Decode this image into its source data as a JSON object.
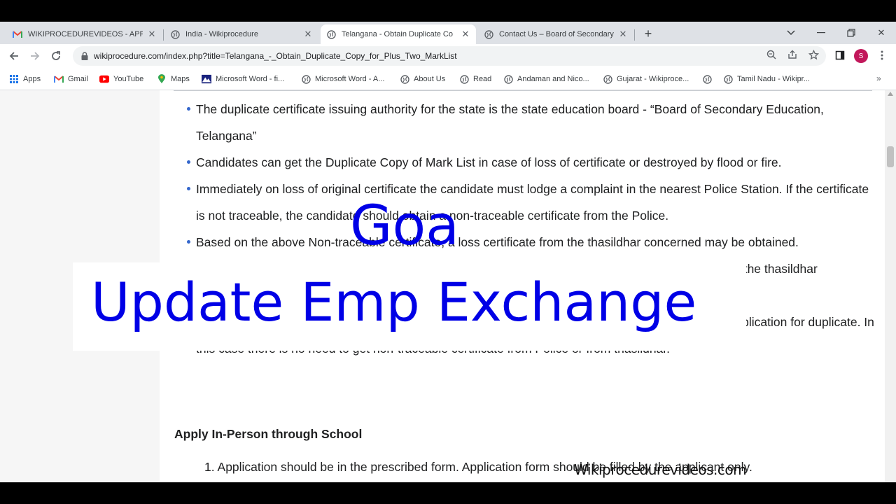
{
  "browser": {
    "tabs": [
      {
        "title": "WIKIPROCEDUREVIDEOS - APRIL",
        "favicon": "gmail-icon",
        "active": false
      },
      {
        "title": "India - Wikiprocedure",
        "favicon": "globe-icon",
        "active": false
      },
      {
        "title": "Telangana - Obtain Duplicate Co",
        "favicon": "globe-icon",
        "active": true
      },
      {
        "title": "Contact Us – Board of Secondary",
        "favicon": "globe-icon",
        "active": false
      }
    ],
    "address_bar": {
      "url": "wikiprocedure.com/index.php?title=Telangana_-_Obtain_Duplicate_Copy_for_Plus_Two_MarkList"
    },
    "profile_initial": "S",
    "bookmarks": [
      {
        "label": "Apps",
        "icon": "apps-grid-icon"
      },
      {
        "label": "Gmail",
        "icon": "gmail-icon"
      },
      {
        "label": "YouTube",
        "icon": "youtube-icon"
      },
      {
        "label": "Maps",
        "icon": "maps-pin-icon"
      },
      {
        "label": "Microsoft Word - fi...",
        "icon": "mountain-icon"
      },
      {
        "label": "Microsoft Word - A...",
        "icon": "globe-icon"
      },
      {
        "label": "About Us",
        "icon": "globe-icon"
      },
      {
        "label": "Read",
        "icon": "globe-icon"
      },
      {
        "label": "Andaman and Nico...",
        "icon": "globe-icon"
      },
      {
        "label": "Gujarat - Wikiproce...",
        "icon": "globe-icon"
      },
      {
        "label": "",
        "icon": "globe-icon"
      },
      {
        "label": "Tamil Nadu - Wikipr...",
        "icon": "globe-icon"
      }
    ],
    "colors": {
      "tab_strip": "#dee1e6",
      "avatar": "#c2185b"
    }
  },
  "article": {
    "bullets": [
      {
        "text": "The duplicate certificate issuing authority for the state is the state education board - “Board of Secondary Education, Telangana”"
      },
      {
        "text": "Candidates can get the Duplicate Copy of Mark List in case of loss of certificate or destroyed by flood or fire."
      },
      {
        "text": "Immediately on loss of original certificate the candidate must lodge a complaint in the nearest Police Station. If the certificate is not traceable, the candidate should obtain a non-traceable certificate from the Police."
      },
      {
        "text": "Based on the above Non-traceable certificate, a loss certificate from the thasildhar concerned may be obtained."
      },
      {
        "text": "In case the certificate was destroyed by flood or fire, a certificate to that effect must be obtained from the thasildhar concerned."
      },
      {
        "text": "In case of a torn or damaged certificate, the damaged certificate must be submitted along with the application for duplicate. In this case there is no need to get non-traceable certificate from Police or from thasildhar."
      }
    ],
    "section_heading": "Apply In-Person through School",
    "ordered_items": [
      {
        "number": "1.",
        "text": "Application should be in the prescribed form. Application form should be filled by the applicant only."
      }
    ]
  },
  "overlay": {
    "state": "Goa",
    "title": "Update Emp Exchange",
    "watermark": "Wikiprocedurevideos.com",
    "color": "#0000e6"
  }
}
